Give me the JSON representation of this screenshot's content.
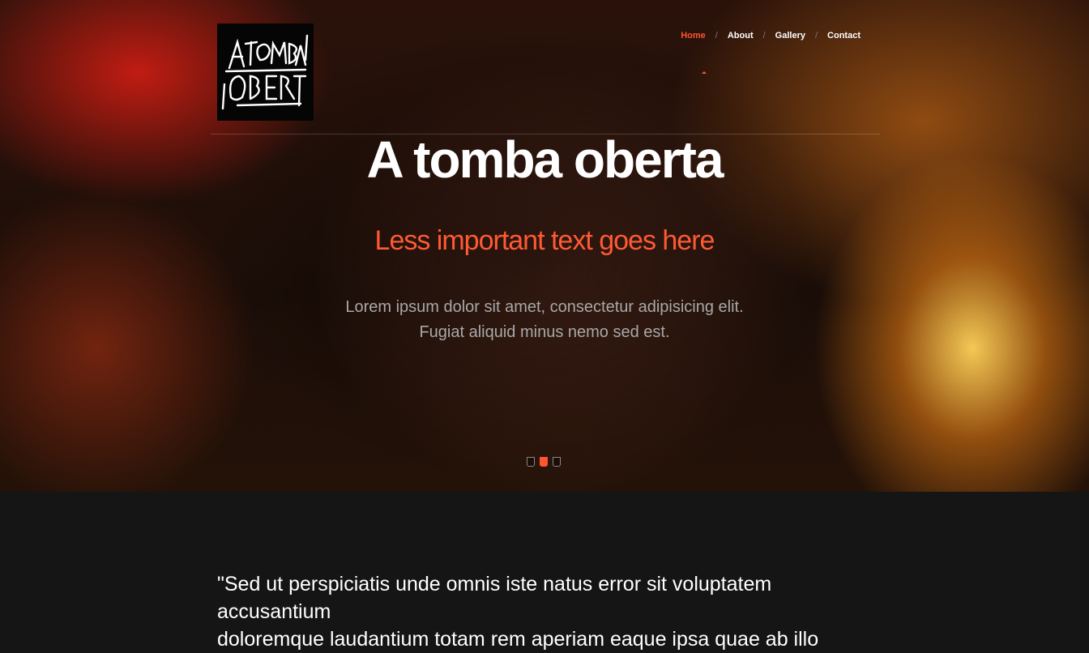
{
  "brand": {
    "logo_alt": "A tomba oberta"
  },
  "nav": {
    "items": [
      {
        "label": "Home",
        "active": true
      },
      {
        "label": "About",
        "active": false
      },
      {
        "label": "Gallery",
        "active": false
      },
      {
        "label": "Contact",
        "active": false
      }
    ],
    "separator": "/",
    "active_color": "#ff5530"
  },
  "hero": {
    "title": "A tomba oberta",
    "subtitle": "Less important text goes here",
    "description_line1": "Lorem ipsum dolor sit amet, consectetur adipisicing elit.",
    "description_line2": "Fugiat aliquid minus nemo sed est.",
    "slides_count": 3,
    "active_slide": 2
  },
  "quote": {
    "line1": "\"Sed ut perspiciatis unde omnis iste natus error sit voluptatem accusantium",
    "line2": "doloremque laudantium totam rem aperiam eaque ipsa quae ab illo"
  },
  "colors": {
    "accent": "#ff5530",
    "background": "#151515"
  }
}
